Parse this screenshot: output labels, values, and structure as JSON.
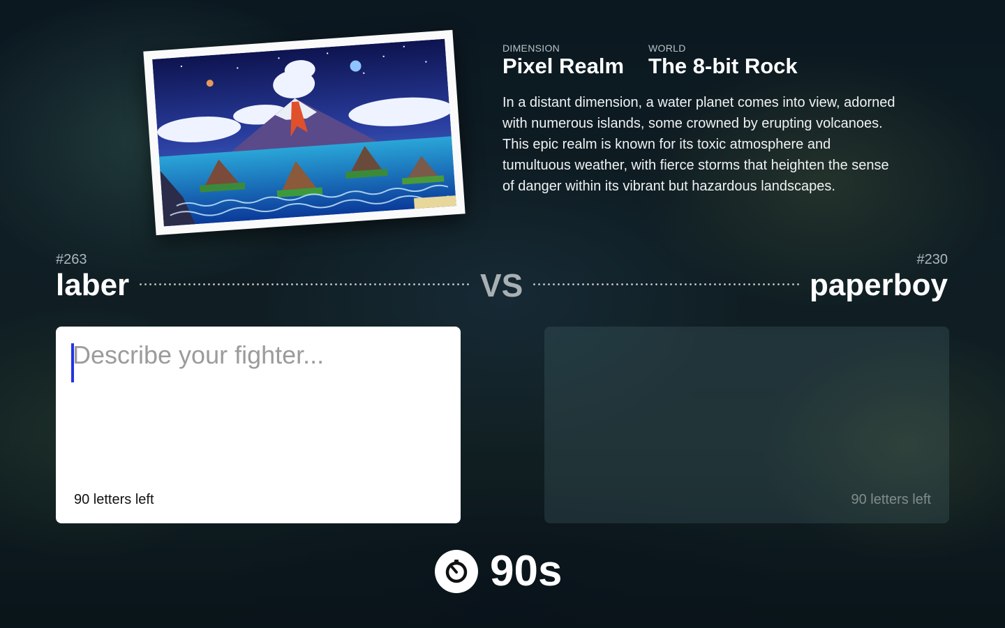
{
  "world": {
    "dimension_label": "DIMENSION",
    "dimension_value": "Pixel Realm",
    "world_label": "WORLD",
    "world_value": "The 8-bit Rock",
    "description": "In a distant dimension, a water planet comes into view, adorned with numerous islands, some crowned by erupting volcanoes. This epic realm is known for its toxic atmosphere and tumultuous weather, with fierce storms that heighten the sense of danger within its vibrant but hazardous landscapes.",
    "image_icon": "pixel-volcano-island-art"
  },
  "versus": {
    "left_player": {
      "number": "#263",
      "name": "laber"
    },
    "vs_label": "VS",
    "right_player": {
      "number": "#230",
      "name": "paperboy"
    }
  },
  "fighter_inputs": {
    "left": {
      "placeholder": "Describe your fighter...",
      "value": "",
      "letters_left": "90 letters left"
    },
    "right": {
      "letters_left": "90 letters left"
    }
  },
  "timer": {
    "icon": "stopwatch-icon",
    "text": "90s"
  },
  "colors": {
    "caret": "#2233e6",
    "card_bg": "#ffffff",
    "vs": "#a9b0b4"
  }
}
